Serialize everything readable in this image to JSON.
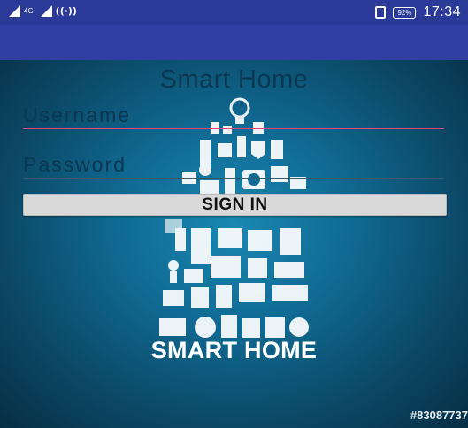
{
  "status_bar": {
    "network_label": "4G",
    "time": "17:34",
    "battery": "92%"
  },
  "login": {
    "title": "Smart Home",
    "username_placeholder": "Username",
    "password_placeholder": "Password",
    "signin_label": "SIGN IN"
  },
  "background": {
    "logo_text": "SMART HOME",
    "watermark": "#83087737"
  },
  "colors": {
    "status_bar": "#2b3a99",
    "app_bar": "#2f3fa3",
    "field_focus_underline": "#e8427a",
    "button": "#d9d9d9"
  },
  "icons": [
    "signal-icon",
    "wifi-icon",
    "vibrate-icon",
    "battery-icon",
    "smart-home-illustration"
  ]
}
